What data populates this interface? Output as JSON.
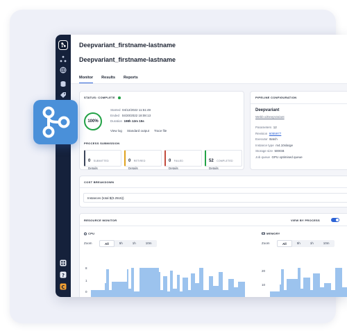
{
  "breadcrumb": "Deepvariant_firstname-lastname",
  "page_title": "Deepvariant_firstname-lastname",
  "tabs": [
    {
      "label": "Monitor"
    },
    {
      "label": "Results"
    },
    {
      "label": "Reports"
    }
  ],
  "status": {
    "title": "STATUS: COMPLETE",
    "progress": "100%",
    "started_label": "Started",
    "started": "04/12/2022 11:51:49",
    "ended_label": "Ended",
    "ended": "04/20/2022 18:08:13",
    "duration_label": "Duration",
    "duration": "198h 12m 15s",
    "links": [
      "View log",
      "Standard output",
      "Trace file"
    ]
  },
  "process_submission": {
    "title": "PROCESS SUBMISSION",
    "boxes": [
      {
        "count": "0",
        "label": "SUBMITTED",
        "details": "Details",
        "color": "#3b4559"
      },
      {
        "count": "0",
        "label": "RETIRED",
        "details": "Details",
        "color": "#e0a21e"
      },
      {
        "count": "0",
        "label": "FAILED",
        "details": "Details",
        "color": "#c24a3c"
      },
      {
        "count": "52",
        "label": "COMPLETED",
        "details": "Details",
        "color": "#22a246"
      }
    ]
  },
  "pipeline": {
    "title": "PIPELINE CONFIGURATION",
    "name": "Deepvariant",
    "repo": "Webb-a/DeepVariant",
    "parameters_label": "Parameters",
    "parameters": "12",
    "revision_label": "Revision",
    "revision": "6055977",
    "executor_label": "Executor",
    "executor": "Batch",
    "instance_label": "Instance type",
    "instance": "m4.10xlarge",
    "storage_label": "Storage size",
    "storage": "500GB",
    "queue_label": "Job queue",
    "queue": "GPU optimised queue"
  },
  "cost": {
    "title": "COST BREAKDOWN",
    "instances": "Instances (total $(0.2515))"
  },
  "resource": {
    "title": "RESOURCE MONITOR",
    "view_label": "VIEW BY PROCESS",
    "cpu": {
      "label": "CPU",
      "zoom_label": "Zoom",
      "zoom_options": [
        "All",
        "5h",
        "1h",
        "10m"
      ],
      "ticks": [
        "8",
        "1",
        "0"
      ]
    },
    "memory": {
      "label": "MEMORY",
      "zoom_label": "Zoom",
      "zoom_options": [
        "All",
        "5h",
        "1h",
        "10m"
      ],
      "ticks": [
        "20",
        "10"
      ]
    }
  },
  "colors": {
    "accent": "#2d63d6",
    "success": "#22a246",
    "chart": "#9cc3ee",
    "sidebar": "#15213b",
    "hero_icon": "#4a90d9"
  },
  "icons": [
    "app-logo-icon",
    "workflow-icon",
    "globe-icon",
    "database-icon",
    "tag-icon",
    "grid-icon",
    "help-icon",
    "user-icon",
    "pipeline-branch-icon"
  ]
}
